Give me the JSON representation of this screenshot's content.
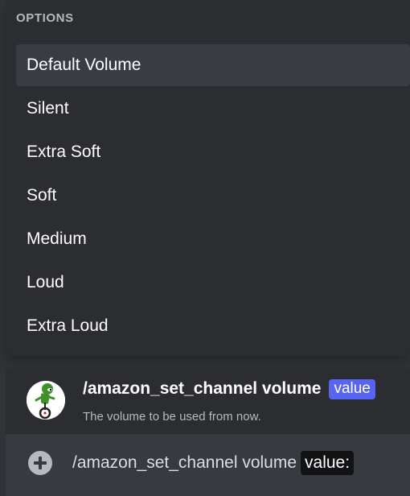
{
  "options": {
    "header": "OPTIONS",
    "items": [
      {
        "label": "Default Volume",
        "active": true
      },
      {
        "label": "Silent"
      },
      {
        "label": "Extra Soft"
      },
      {
        "label": "Soft"
      },
      {
        "label": "Medium"
      },
      {
        "label": "Loud"
      },
      {
        "label": "Extra Loud"
      }
    ]
  },
  "command": {
    "name": "/amazon_set_channel volume",
    "param": "value",
    "description": "The volume to be used from now."
  },
  "input": {
    "text": "/amazon_set_channel volume",
    "param_label": "value:"
  },
  "icons": {
    "add": "plus-circle-icon",
    "avatar": "bot-avatar"
  },
  "colors": {
    "background": "#313338",
    "panel": "#2b2d31",
    "active_item": "#393c42",
    "accent": "#5865f2",
    "input_bar": "#383a40"
  }
}
